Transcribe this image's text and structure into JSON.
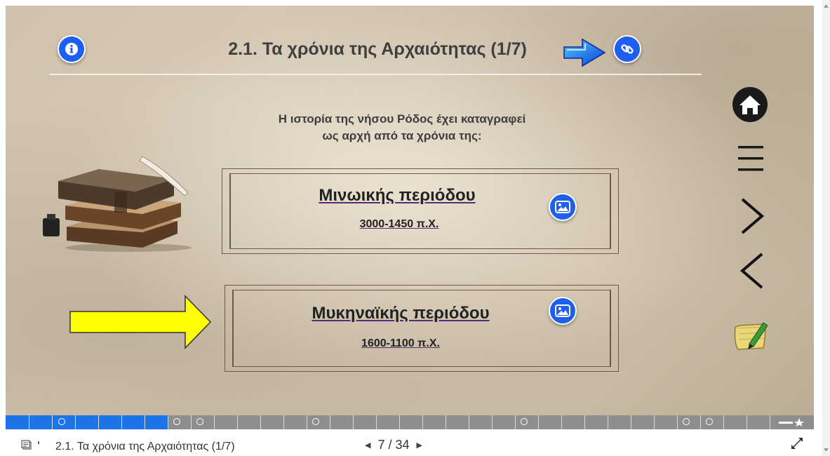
{
  "header": {
    "title": "2.1. Τα χρόνια της Αρχαιότητας (1/7)",
    "info_icon": "info-icon",
    "link_icon": "link-icon"
  },
  "intro": {
    "line1": "Η ιστορία της νήσου Ρόδος έχει καταγραφεί",
    "line2": "ως αρχή από τα χρόνια της:"
  },
  "periods": [
    {
      "name": "Μινωικής περιόδου",
      "dates": "3000-1450 π.Χ.",
      "icon": "image-icon"
    },
    {
      "name": "Μυκηναϊκής περιόδου",
      "dates": "1600-1100 π.Χ.",
      "icon": "image-icon"
    }
  ],
  "nav": {
    "home": "home-icon",
    "menu": "menu-icon",
    "next": "chevron-right-icon",
    "prev": "chevron-left-icon",
    "notes": "notes-icon"
  },
  "colors": {
    "accent": "#1f5ff0",
    "progress_fill": "#1d73e8",
    "arrow_yellow": "#ffff00"
  },
  "progress": {
    "current": 7,
    "total": 34,
    "fraction": 0.2059
  },
  "status_bar": {
    "slide_title": "2.1. Τα χρόνια της Αρχαιότητας (1/7)",
    "page_label": "7 / 34"
  }
}
